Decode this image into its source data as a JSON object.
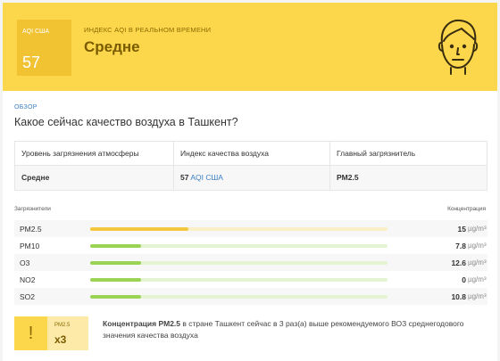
{
  "header": {
    "aqi_label": "AQI США",
    "aqi_value": "57",
    "realtime_label": "Индекс AQI в реальном времени",
    "level": "Средне",
    "colors": {
      "header_bg": "#fdd74b",
      "aqi_box": "#f1c232"
    }
  },
  "overview": {
    "label": "Обзор",
    "question": "Какое сейчас качество воздуха в Ташкент?"
  },
  "summary": {
    "headers": [
      "Уровень загрязнения атмосферы",
      "Индекс качества воздуха",
      "Главный загрязнитель"
    ],
    "level": "Средне",
    "index_value": "57",
    "index_unit": "AQI США",
    "main_pollutant": "PM2.5"
  },
  "pollutants": {
    "header_left": "Загрязнители",
    "header_right": "Концентрация",
    "unit": "µg/m³",
    "items": [
      {
        "name": "PM2.5",
        "value": "15",
        "fill_fraction": 0.33,
        "color": "#f5c842",
        "track": "#fbefc7"
      },
      {
        "name": "PM10",
        "value": "7.8",
        "fill_fraction": 0.17,
        "color": "#9bd454",
        "track": "#e4f4d2"
      },
      {
        "name": "O3",
        "value": "12.6",
        "fill_fraction": 0.17,
        "color": "#9bd454",
        "track": "#e4f4d2"
      },
      {
        "name": "NO2",
        "value": "0",
        "fill_fraction": 0.17,
        "color": "#9bd454",
        "track": "#e4f4d2"
      },
      {
        "name": "SO2",
        "value": "10.8",
        "fill_fraction": 0.17,
        "color": "#9bd454",
        "track": "#e4f4d2"
      }
    ]
  },
  "note": {
    "pm_label": "PM2.5",
    "multiplier": "x3",
    "icon": "!",
    "bold_text": "Концентрация PM2.5",
    "text": " в стране Ташкент сейчас в 3 раз(а) выше рекомендуемого ВОЗ среднегодового значения качества воздуха"
  }
}
